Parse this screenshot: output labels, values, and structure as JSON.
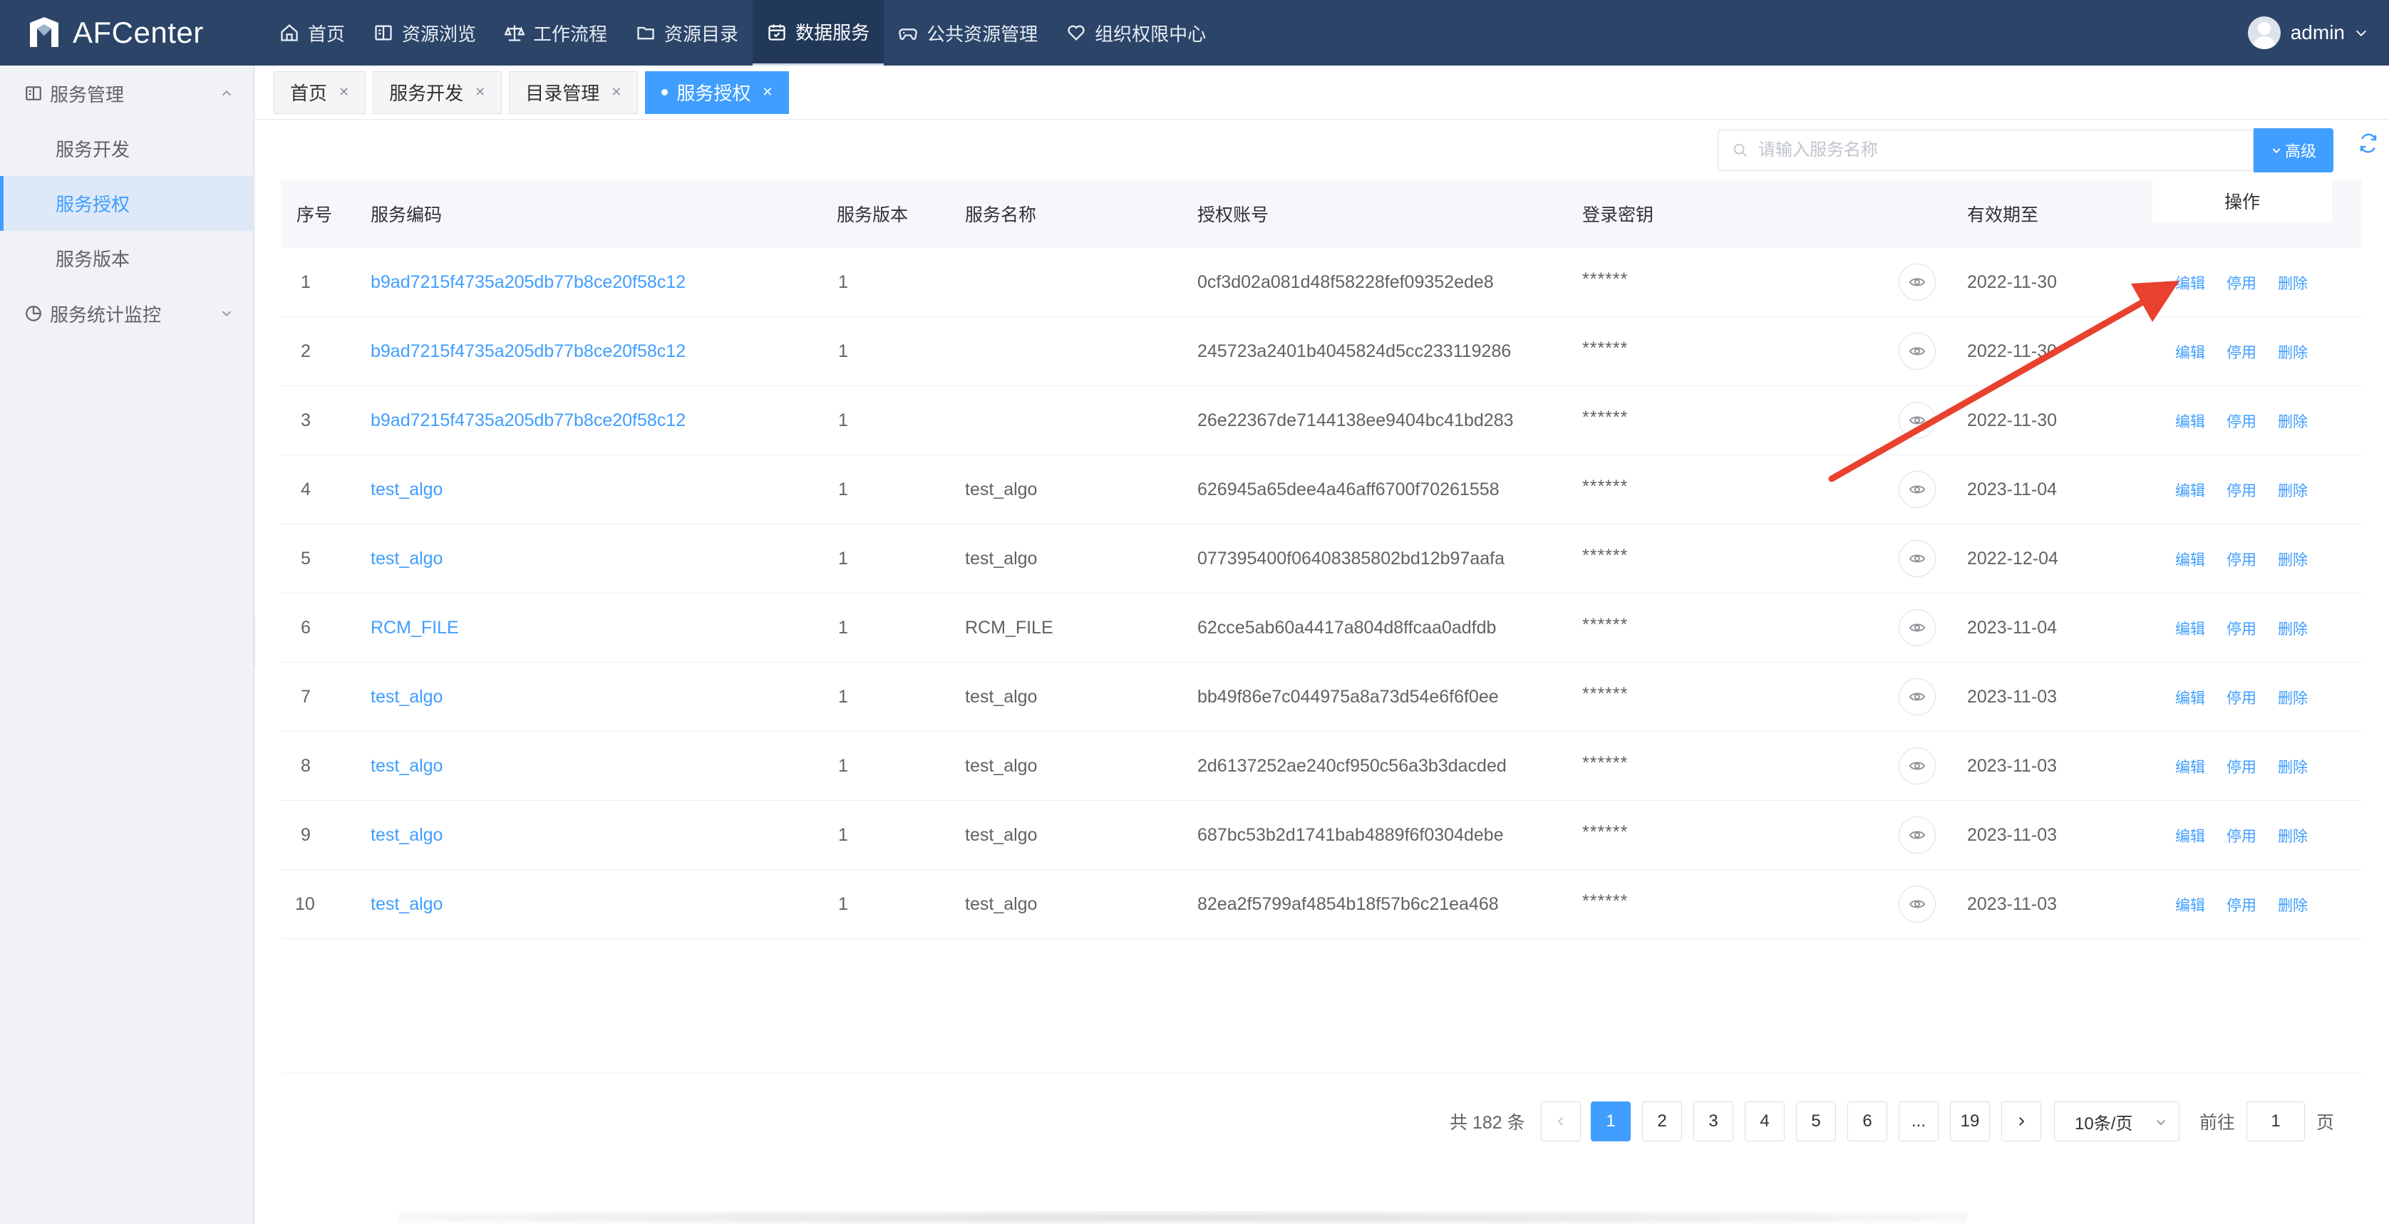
{
  "app": {
    "logo_text": "AFCenter",
    "user_name": "admin"
  },
  "nav": {
    "items": [
      {
        "label": "首页",
        "icon": "home-icon"
      },
      {
        "label": "资源浏览",
        "icon": "book-icon"
      },
      {
        "label": "工作流程",
        "icon": "scale-icon"
      },
      {
        "label": "资源目录",
        "icon": "folder-icon"
      },
      {
        "label": "数据服务",
        "icon": "calendar-check-icon",
        "active": true
      },
      {
        "label": "公共资源管理",
        "icon": "gamepad-icon"
      },
      {
        "label": "组织权限中心",
        "icon": "heart-shield-icon"
      }
    ]
  },
  "sidebar": {
    "group1": {
      "label": "服务管理",
      "icon": "book-icon"
    },
    "items": [
      {
        "label": "服务开发"
      },
      {
        "label": "服务授权",
        "active": true
      },
      {
        "label": "服务版本"
      }
    ],
    "group2": {
      "label": "服务统计监控",
      "icon": "pie-chart-icon"
    }
  },
  "tabs": [
    {
      "label": "首页"
    },
    {
      "label": "服务开发"
    },
    {
      "label": "目录管理"
    },
    {
      "label": "服务授权",
      "active": true
    }
  ],
  "search": {
    "placeholder": "请输入服务名称",
    "advanced_label": "高级"
  },
  "table": {
    "columns": {
      "index": "序号",
      "code": "服务编码",
      "version": "服务版本",
      "name": "服务名称",
      "account": "授权账号",
      "secret": "登录密钥",
      "expiry": "有效期至",
      "ops": "操作"
    },
    "rows": [
      {
        "index": "1",
        "code": "b9ad7215f4735a205db77b8ce20f58c12",
        "version": "1",
        "name": "",
        "account": "0cf3d02a081d48f58228fef09352ede8",
        "secret": "******",
        "expiry": "2022-11-30"
      },
      {
        "index": "2",
        "code": "b9ad7215f4735a205db77b8ce20f58c12",
        "version": "1",
        "name": "",
        "account": "245723a2401b4045824d5cc233119286",
        "secret": "******",
        "expiry": "2022-11-30"
      },
      {
        "index": "3",
        "code": "b9ad7215f4735a205db77b8ce20f58c12",
        "version": "1",
        "name": "",
        "account": "26e22367de7144138ee9404bc41bd283",
        "secret": "******",
        "expiry": "2022-11-30"
      },
      {
        "index": "4",
        "code": "test_algo",
        "version": "1",
        "name": "test_algo",
        "account": "626945a65dee4a46aff6700f70261558",
        "secret": "******",
        "expiry": "2023-11-04"
      },
      {
        "index": "5",
        "code": "test_algo",
        "version": "1",
        "name": "test_algo",
        "account": "077395400f06408385802bd12b97aafa",
        "secret": "******",
        "expiry": "2022-12-04"
      },
      {
        "index": "6",
        "code": "RCM_FILE",
        "version": "1",
        "name": "RCM_FILE",
        "account": "62cce5ab60a4417a804d8ffcaa0adfdb",
        "secret": "******",
        "expiry": "2023-11-04"
      },
      {
        "index": "7",
        "code": "test_algo",
        "version": "1",
        "name": "test_algo",
        "account": "bb49f86e7c044975a8a73d54e6f6f0ee",
        "secret": "******",
        "expiry": "2023-11-03"
      },
      {
        "index": "8",
        "code": "test_algo",
        "version": "1",
        "name": "test_algo",
        "account": "2d6137252ae240cf950c56a3b3dacded",
        "secret": "******",
        "expiry": "2023-11-03"
      },
      {
        "index": "9",
        "code": "test_algo",
        "version": "1",
        "name": "test_algo",
        "account": "687bc53b2d1741bab4889f6f0304debe",
        "secret": "******",
        "expiry": "2023-11-03"
      },
      {
        "index": "10",
        "code": "test_algo",
        "version": "1",
        "name": "test_algo",
        "account": "82ea2f5799af4854b18f57b6c21ea468",
        "secret": "******",
        "expiry": "2023-11-03"
      }
    ],
    "actions": {
      "edit": "编辑",
      "disable": "停用",
      "delete": "删除"
    }
  },
  "pagination": {
    "total_text": "共 182 条",
    "pages": [
      "1",
      "2",
      "3",
      "4",
      "5",
      "6",
      "...",
      "19"
    ],
    "current": "1",
    "page_size": "10条/页",
    "jump_prefix": "前往",
    "jump_value": "1",
    "jump_suffix": "页"
  },
  "colors": {
    "primary": "#409eff",
    "topbar": "#2b4468",
    "annotation_arrow": "#e8412e"
  }
}
